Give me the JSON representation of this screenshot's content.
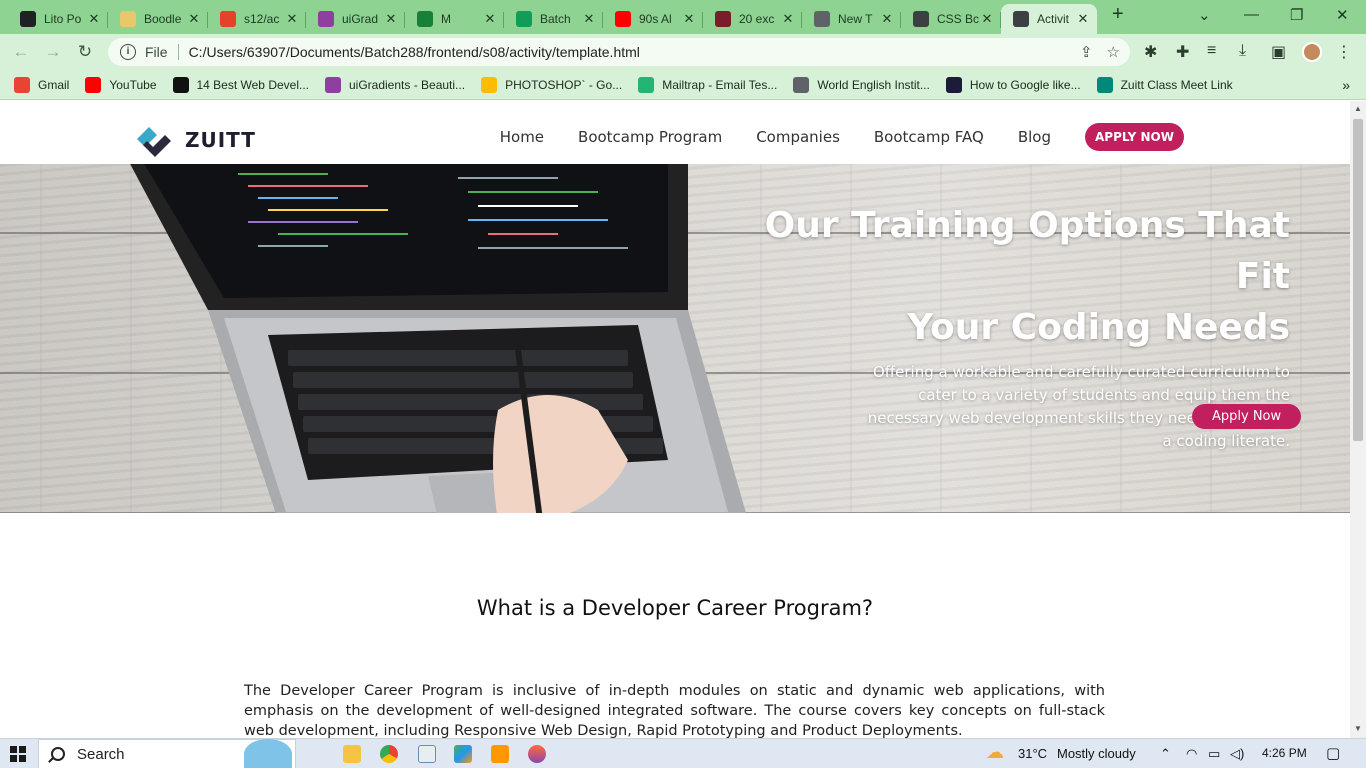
{
  "browser": {
    "tabs": [
      {
        "title": "Lito Po",
        "icon": "tab-icon-lito",
        "color": "#202124"
      },
      {
        "title": "Boodle",
        "icon": "tab-icon-boodle",
        "color": "#e8c86b"
      },
      {
        "title": "s12/ac",
        "icon": "tab-icon-gitlab",
        "color": "#e24329"
      },
      {
        "title": "uiGrad",
        "icon": "tab-icon-uigradients",
        "color": "#8e3fa0"
      },
      {
        "title": "M",
        "icon": "tab-icon-meet",
        "color": "#188038"
      },
      {
        "title": "Batch",
        "icon": "tab-icon-chat",
        "color": "#0f9d58"
      },
      {
        "title": "90s Al",
        "icon": "tab-icon-youtube",
        "color": "#ff0000"
      },
      {
        "title": "20 exc",
        "icon": "tab-icon-w",
        "color": "#7a1d2a"
      },
      {
        "title": "New T",
        "icon": "tab-icon-chrome",
        "color": "#5f6368"
      },
      {
        "title": "CSS Bc",
        "icon": "tab-icon-globe",
        "color": "#3c4043"
      },
      {
        "title": "Activit",
        "icon": "tab-icon-globe",
        "color": "#3c4043",
        "active": true
      }
    ],
    "new_tab": "+",
    "url_scheme": "File",
    "url": "C:/Users/63907/Documents/Batch288/frontend/s08/activity/template.html",
    "bookmarks": [
      {
        "label": "Gmail",
        "icon": "gmail-icon",
        "color": "#ea4335"
      },
      {
        "label": "YouTube",
        "icon": "youtube-icon",
        "color": "#ff0000"
      },
      {
        "label": "14 Best Web Devel...",
        "icon": "bookmark-icon",
        "color": "#111111"
      },
      {
        "label": "uiGradients - Beauti...",
        "icon": "uigradients-icon",
        "color": "#8e3fa0"
      },
      {
        "label": "PHOTOSHOP` - Go...",
        "icon": "drive-icon",
        "color": "#fbbc04"
      },
      {
        "label": "Mailtrap - Email Tes...",
        "icon": "mailtrap-icon",
        "color": "#22b573"
      },
      {
        "label": "World English Instit...",
        "icon": "globe-icon",
        "color": "#5f6368"
      },
      {
        "label": "How to Google like...",
        "icon": "bookmark-icon",
        "color": "#1c1c3a"
      },
      {
        "label": "Zuitt Class Meet Link",
        "icon": "meet-icon",
        "color": "#00897b"
      }
    ],
    "bookmarks_more": "»"
  },
  "site": {
    "logo_text": "ZUITT",
    "nav": [
      "Home",
      "Bootcamp Program",
      "Companies",
      "Bootcamp FAQ",
      "Blog"
    ],
    "nav_cta": "APPLY NOW",
    "hero": {
      "title_line1": "Our Training Options That Fit",
      "title_line2": "Your Coding Needs",
      "subtitle": "Offering a workable and carefully curated curriculum to cater to a variety of students and equip them the necessary web development skills they need to become a coding literate.",
      "button": "Apply Now"
    },
    "section": {
      "title": "What is a Developer Career Program?",
      "body": "The Developer Career Program is inclusive of in-depth modules on static and dynamic web applications, with emphasis on the development of well-designed integrated software. The course covers key concepts on full-stack web development, including Responsive Web Design, Rapid Prototyping and Product Deployments."
    },
    "accent_color": "#c21f5e"
  },
  "taskbar": {
    "search_label": "Search",
    "temperature": "31°C",
    "weather": "Mostly cloudy",
    "time": "4:26 PM"
  }
}
